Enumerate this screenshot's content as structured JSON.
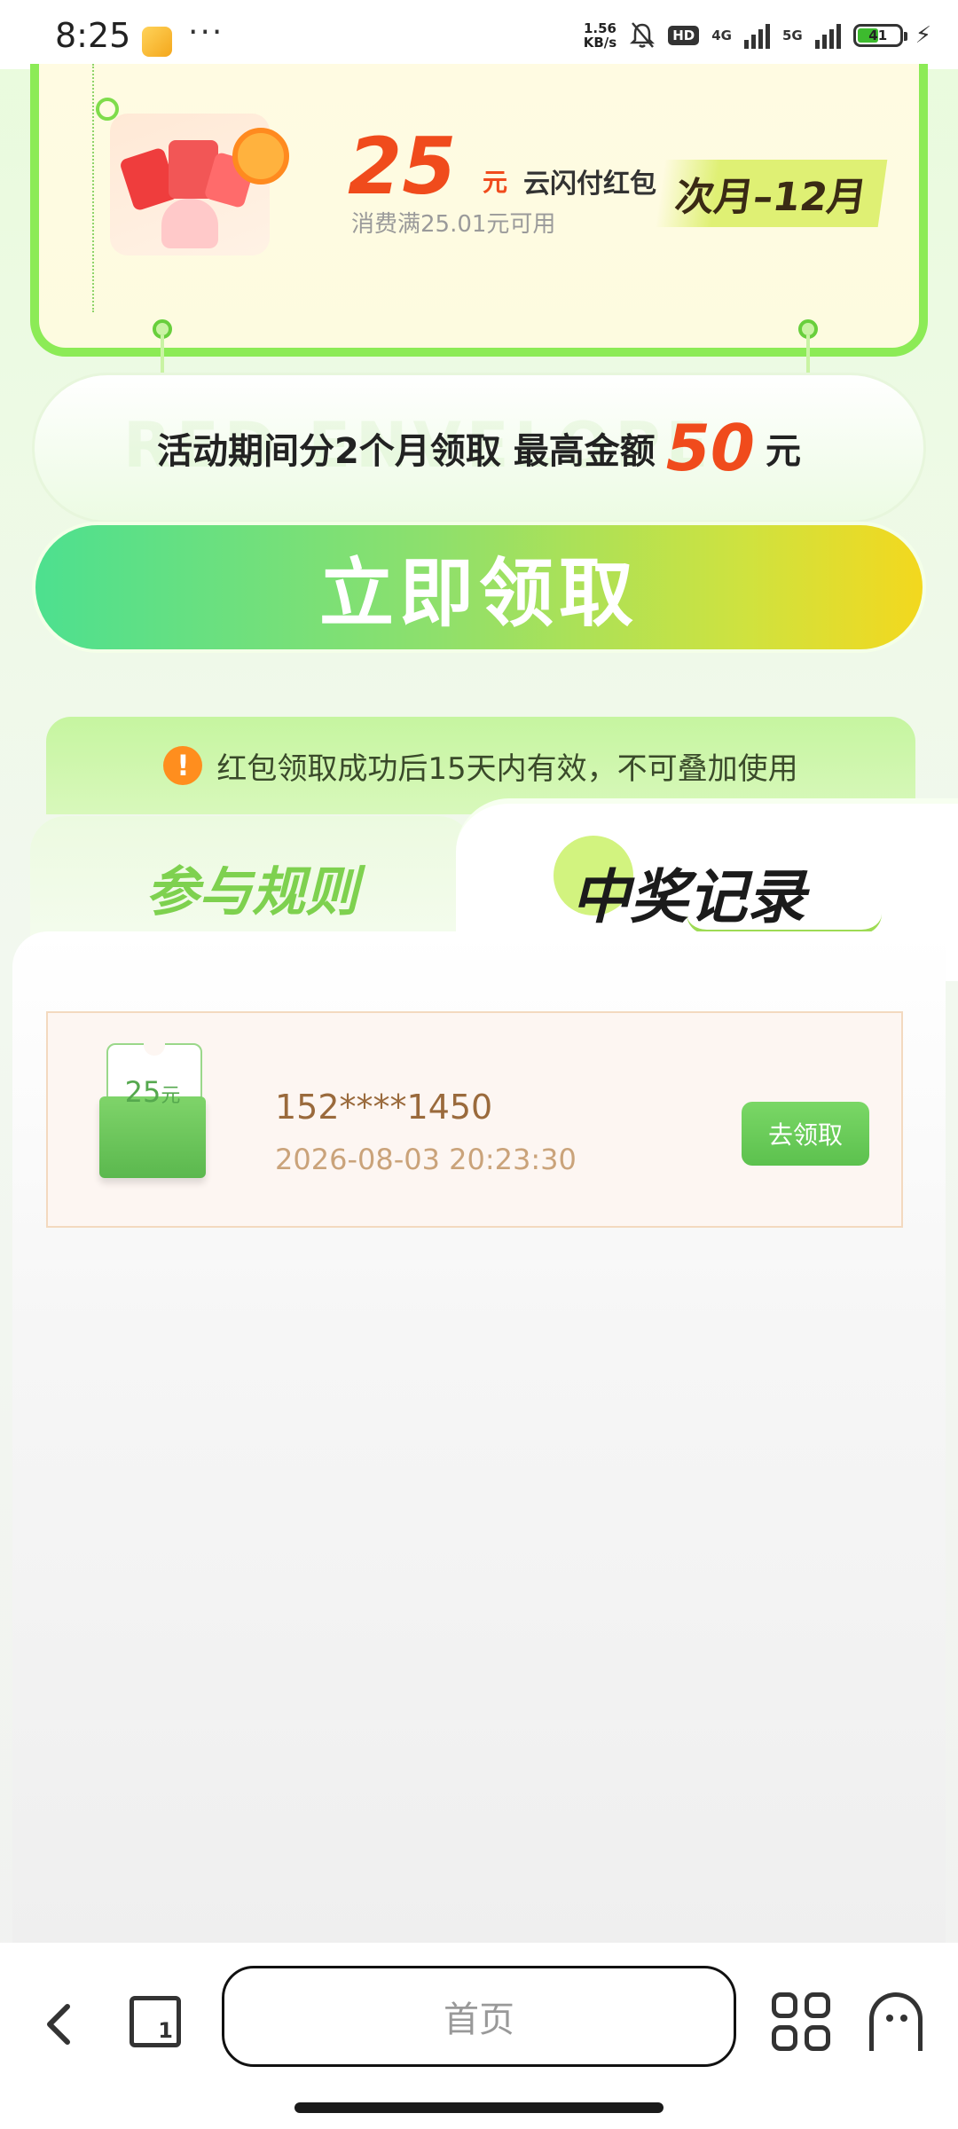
{
  "status_bar": {
    "time": "8:25",
    "dots": "···",
    "speed_value": "1.56",
    "speed_unit": "KB/s",
    "hd": "HD",
    "net1": "4G",
    "net2": "5G",
    "battery": "41"
  },
  "coupon": {
    "amount": "25",
    "unit": "元",
    "name": "云闪付红包",
    "condition": "消费满25.01元可用",
    "period": "次月–12月"
  },
  "info": {
    "prefix": "活动期间分2个月领取  最高金额",
    "max_amount": "50",
    "suffix": "元",
    "watermark": "RED ENVELOPE"
  },
  "claim_button": "立即领取",
  "notice": {
    "icon": "warning-icon",
    "text": "红包领取成功后15天内有效，不可叠加使用"
  },
  "tabs": [
    {
      "label": "参与规则",
      "active": false
    },
    {
      "label": "中奖记录",
      "active": true
    }
  ],
  "records": [
    {
      "amount": "25",
      "unit": "元",
      "phone": "152****1450",
      "time": "2026-08-03 20:23:30",
      "action": "去领取"
    }
  ],
  "browser": {
    "address": "首页",
    "tab_count": "1"
  },
  "colors": {
    "accent_green": "#7ed14f",
    "amount_red": "#f04b1c",
    "button_gradient_start": "#4de08f",
    "button_gradient_end": "#f3d81e"
  }
}
